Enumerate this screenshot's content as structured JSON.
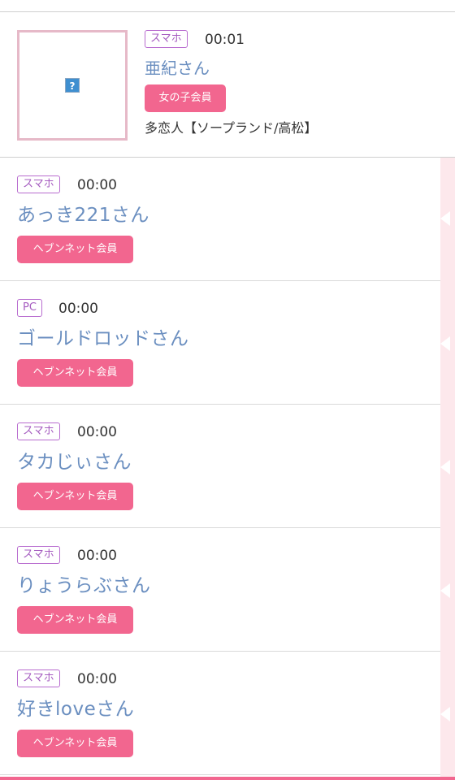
{
  "featured": {
    "device": "スマホ",
    "time": "00:01",
    "name": "亜紀さん",
    "badge": "女の子会員",
    "shop": "多恋人【ソープランド/高松】",
    "thumbnail_icon": "?"
  },
  "members": [
    {
      "device": "スマホ",
      "time": "00:00",
      "name": "あっき221さん",
      "badge": "ヘブンネット会員"
    },
    {
      "device": "PC",
      "time": "00:00",
      "name": "ゴールドロッドさん",
      "badge": "ヘブンネット会員"
    },
    {
      "device": "スマホ",
      "time": "00:00",
      "name": "タカじぃさん",
      "badge": "ヘブンネット会員"
    },
    {
      "device": "スマホ",
      "time": "00:00",
      "name": "りょうらぶさん",
      "badge": "ヘブンネット会員"
    },
    {
      "device": "スマホ",
      "time": "00:00",
      "name": "好きloveさん",
      "badge": "ヘブンネット会員"
    }
  ],
  "colors": {
    "accent_pink": "#f2668f",
    "name_blue": "#6b8fc0",
    "tag_purple": "#a55cc0",
    "side_strip": "#fde8ec"
  },
  "icons": {
    "broken_image": "broken-image-icon",
    "side_arrow": "arrow-left-icon"
  }
}
